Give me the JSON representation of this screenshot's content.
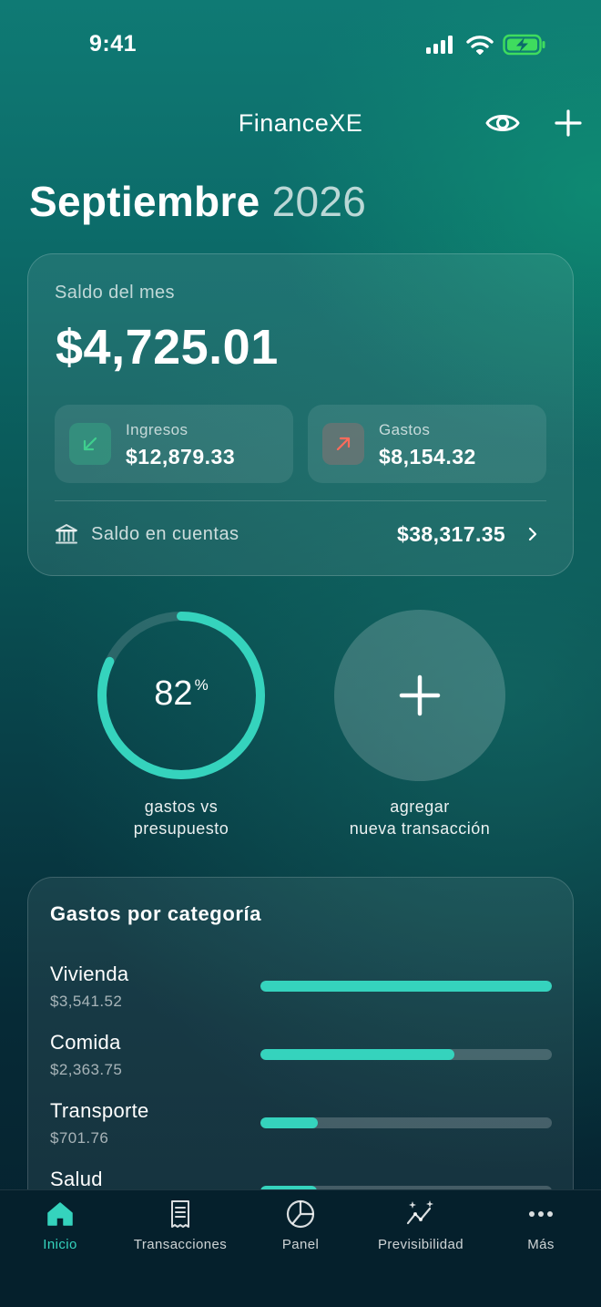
{
  "status_bar": {
    "time": "9:41"
  },
  "header": {
    "title": "FinanceXE",
    "eye_icon": "eye-icon",
    "add_icon": "plus-icon"
  },
  "period": {
    "month": "Septiembre",
    "year": "2026"
  },
  "balance": {
    "label": "Saldo del mes",
    "amount": "$4,725.01",
    "income": {
      "label": "Ingresos",
      "value": "$12,879.33",
      "icon": "arrow-down-left-icon"
    },
    "expense": {
      "label": "Gastos",
      "value": "$8,154.32",
      "icon": "arrow-up-right-icon"
    },
    "accounts": {
      "label": "Saldo en cuentas",
      "value": "$38,317.35",
      "icon": "bank-icon"
    }
  },
  "budget": {
    "percent": 82,
    "value": "82",
    "unit": "%",
    "caption_line1": "gastos vs",
    "caption_line2": "presupuesto"
  },
  "add_transaction": {
    "caption_line1": "agregar",
    "caption_line2": "nueva transacción"
  },
  "categories": {
    "title": "Gastos por categoría",
    "items": [
      {
        "name": "Vivienda",
        "amount": "$3,541.52",
        "fraction": 1.0
      },
      {
        "name": "Comida",
        "amount": "$2,363.75",
        "fraction": 0.667
      },
      {
        "name": "Transporte",
        "amount": "$701.76",
        "fraction": 0.198
      },
      {
        "name": "Salud",
        "amount": "",
        "fraction": 0.195
      }
    ]
  },
  "tabs": [
    {
      "label": "Inicio",
      "icon": "home-icon",
      "active": true
    },
    {
      "label": "Transacciones",
      "icon": "receipt-icon",
      "active": false
    },
    {
      "label": "Panel",
      "icon": "pie-chart-icon",
      "active": false
    },
    {
      "label": "Previsibilidad",
      "icon": "sparkle-chart-icon",
      "active": false
    },
    {
      "label": "Más",
      "icon": "more-icon",
      "active": false
    }
  ],
  "colors": {
    "accent": "#35d3bd",
    "income_arrow": "#3fcf8e",
    "expense_arrow": "#ff6b5b"
  }
}
